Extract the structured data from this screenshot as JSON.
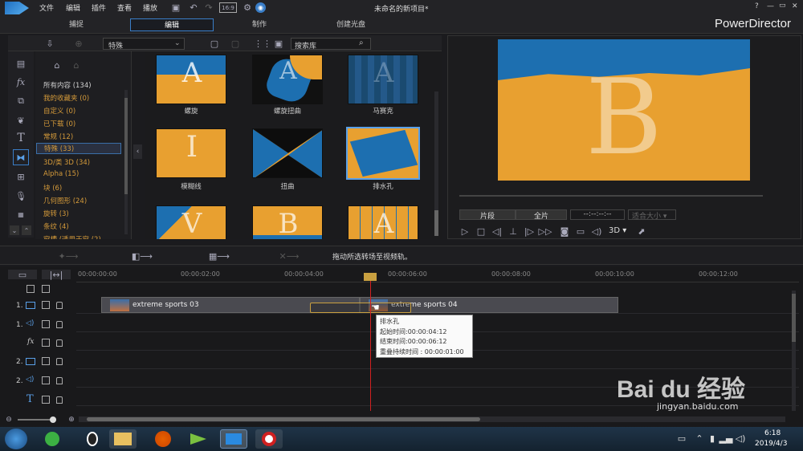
{
  "menu": {
    "file": "文件",
    "edit": "编辑",
    "plugin": "插件",
    "view": "查看",
    "play": "播放"
  },
  "window_title": "未命名的新项目*",
  "app_name": "PowerDirector",
  "window_buttons": {
    "help": "?",
    "min": "—",
    "restore": "▭",
    "close": "✕"
  },
  "tabs": {
    "capture": "捕捉",
    "edit": "编辑",
    "produce": "制作",
    "disc": "创建光盘"
  },
  "library": {
    "category_dropdown": "特殊",
    "search_placeholder": "搜索库",
    "categories": [
      "所有内容 (134)",
      "我的收藏夹 (0)",
      "自定义 (0)",
      "已下载 (0)",
      "常规 (12)",
      "特殊 (33)",
      "3D/类 3D (34)",
      "Alpha (15)",
      "块 (6)",
      "几何图形 (24)",
      "旋转 (3)",
      "条纹 (4)",
      "窗槽 (透用于窗 (2)"
    ],
    "items": [
      {
        "label": "螺旋",
        "letter": "A"
      },
      {
        "label": "螺旋扭曲",
        "letter": "A"
      },
      {
        "label": "马赛克",
        "letter": "A"
      },
      {
        "label": "模糊线",
        "letter": "I"
      },
      {
        "label": "扭曲",
        "letter": ""
      },
      {
        "label": "排水孔",
        "letter": ""
      },
      {
        "label": "",
        "letter": "V"
      },
      {
        "label": "",
        "letter": "B"
      },
      {
        "label": "",
        "letter": "A"
      }
    ]
  },
  "preview": {
    "letter": "B",
    "mode_clip": "片段",
    "mode_movie": "全片",
    "timecode": "--:--:--:--",
    "size_label": "适合大小",
    "three_d": "3D"
  },
  "toolbar": {
    "hint": "拖动所选转场至视频轨。"
  },
  "ruler": [
    "00:00:00:00",
    "00:00:02:00",
    "00:00:04:00",
    "00:00:06:00",
    "00:00:08:00",
    "00:00:10:00",
    "00:00:12:00"
  ],
  "tracks": [
    {
      "num": "1.",
      "type": "video"
    },
    {
      "num": "1.",
      "type": "audio"
    },
    {
      "num": "",
      "type": "fx"
    },
    {
      "num": "2.",
      "type": "video"
    },
    {
      "num": "2.",
      "type": "audio"
    },
    {
      "num": "",
      "type": "title"
    }
  ],
  "clips": {
    "clip1": "extreme sports 03",
    "clip2": "extreme sports 04"
  },
  "tooltip": {
    "name": "排水孔",
    "start": "起始时间:00:00:04:12",
    "end": "结束时间:00:00:06:12",
    "overlap": "重叠持续时间 : 00:00:01:00"
  },
  "clock": {
    "time": "6:18",
    "date": "2019/4/3"
  },
  "watermark": {
    "brand": "Bai du 经验",
    "url": "jingyan.baidu.com"
  },
  "colors": {
    "accent": "#3a7ec8",
    "category": "#d49a3a",
    "playhead": "#d02020"
  }
}
